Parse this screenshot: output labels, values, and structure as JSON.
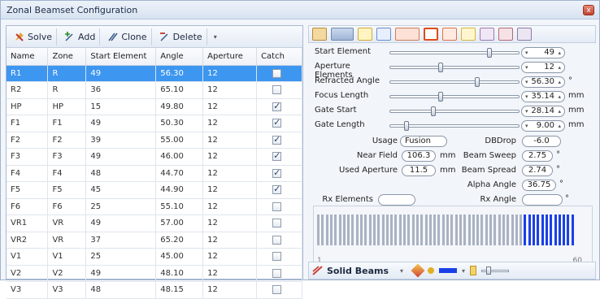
{
  "window": {
    "title": "Zonal Beamset Configuration",
    "close_glyph": "x"
  },
  "toolbar": {
    "solve_label": "Solve",
    "add_label": "Add",
    "clone_label": "Clone",
    "delete_label": "Delete",
    "dropdown_glyph": "▾"
  },
  "table": {
    "headers": [
      "Name",
      "Zone",
      "Start Element",
      "Angle",
      "Aperture",
      "Catch"
    ],
    "rows": [
      {
        "name": "R1",
        "zone": "R",
        "start": "49",
        "angle": "56.30",
        "aperture": "12",
        "catch": false,
        "selected": true
      },
      {
        "name": "R2",
        "zone": "R",
        "start": "36",
        "angle": "65.10",
        "aperture": "12",
        "catch": false,
        "selected": false
      },
      {
        "name": "HP",
        "zone": "HP",
        "start": "15",
        "angle": "49.80",
        "aperture": "12",
        "catch": true,
        "selected": false
      },
      {
        "name": "F1",
        "zone": "F1",
        "start": "49",
        "angle": "50.30",
        "aperture": "12",
        "catch": true,
        "selected": false
      },
      {
        "name": "F2",
        "zone": "F2",
        "start": "39",
        "angle": "55.00",
        "aperture": "12",
        "catch": true,
        "selected": false
      },
      {
        "name": "F3",
        "zone": "F3",
        "start": "49",
        "angle": "46.00",
        "aperture": "12",
        "catch": true,
        "selected": false
      },
      {
        "name": "F4",
        "zone": "F4",
        "start": "48",
        "angle": "44.70",
        "aperture": "12",
        "catch": true,
        "selected": false
      },
      {
        "name": "F5",
        "zone": "F5",
        "start": "45",
        "angle": "44.90",
        "aperture": "12",
        "catch": true,
        "selected": false
      },
      {
        "name": "F6",
        "zone": "F6",
        "start": "25",
        "angle": "55.10",
        "aperture": "12",
        "catch": false,
        "selected": false
      },
      {
        "name": "VR1",
        "zone": "VR",
        "start": "49",
        "angle": "57.00",
        "aperture": "12",
        "catch": false,
        "selected": false
      },
      {
        "name": "VR2",
        "zone": "VR",
        "start": "37",
        "angle": "65.20",
        "aperture": "12",
        "catch": false,
        "selected": false
      },
      {
        "name": "V1",
        "zone": "V1",
        "start": "25",
        "angle": "45.00",
        "aperture": "12",
        "catch": false,
        "selected": false
      },
      {
        "name": "V2",
        "zone": "V2",
        "start": "49",
        "angle": "48.10",
        "aperture": "12",
        "catch": false,
        "selected": false
      },
      {
        "name": "V3",
        "zone": "V3",
        "start": "48",
        "angle": "48.15",
        "aperture": "12",
        "catch": false,
        "selected": false
      }
    ]
  },
  "params": {
    "start_element": {
      "label": "Start Element",
      "value": "49",
      "unit": "",
      "level": 0.8
    },
    "aperture_elements": {
      "label": "Aperture Elements",
      "value": "12",
      "unit": "",
      "level": 0.4
    },
    "refracted_angle": {
      "label": "Refracted Angle",
      "value": "56.30",
      "unit": "°",
      "level": 0.7
    },
    "focus_length": {
      "label": "Focus Length",
      "value": "35.14",
      "unit": "mm",
      "level": 0.4
    },
    "gate_start": {
      "label": "Gate Start",
      "value": "28.14",
      "unit": "mm",
      "level": 0.34
    },
    "gate_length": {
      "label": "Gate Length",
      "value": "9.00",
      "unit": "mm",
      "level": 0.12
    }
  },
  "details": {
    "usage_label": "Usage",
    "usage_value": "Fusion",
    "dbdrop_label": "DBDrop",
    "dbdrop_value": "-6.0",
    "near_field_label": "Near Field",
    "near_field_value": "106.3",
    "near_field_unit": "mm",
    "beam_sweep_label": "Beam Sweep",
    "beam_sweep_value": "2.75",
    "used_aperture_label": "Used Aperture",
    "used_aperture_value": "11.5",
    "used_aperture_unit": "mm",
    "beam_spread_label": "Beam Spread",
    "beam_spread_value": "2.74",
    "alpha_angle_label": "Alpha Angle",
    "alpha_angle_value": "36.75",
    "rx_elements_label": "Rx Elements",
    "rx_elements_value": "",
    "rx_angle_label": "Rx Angle",
    "rx_angle_value": "",
    "degree_unit": "°"
  },
  "beams_view": {
    "scale_min": "1",
    "scale_max": "60",
    "total_elements": 60,
    "active_start": 49,
    "active_end": 60,
    "inactive_color": "#aab2c2",
    "active_color": "#1a3fe8"
  },
  "bottom_toolbar": {
    "view_label": "Solid Beams"
  },
  "colors": {
    "selection": "#3d96f0",
    "accent": "#1a3fe8"
  }
}
